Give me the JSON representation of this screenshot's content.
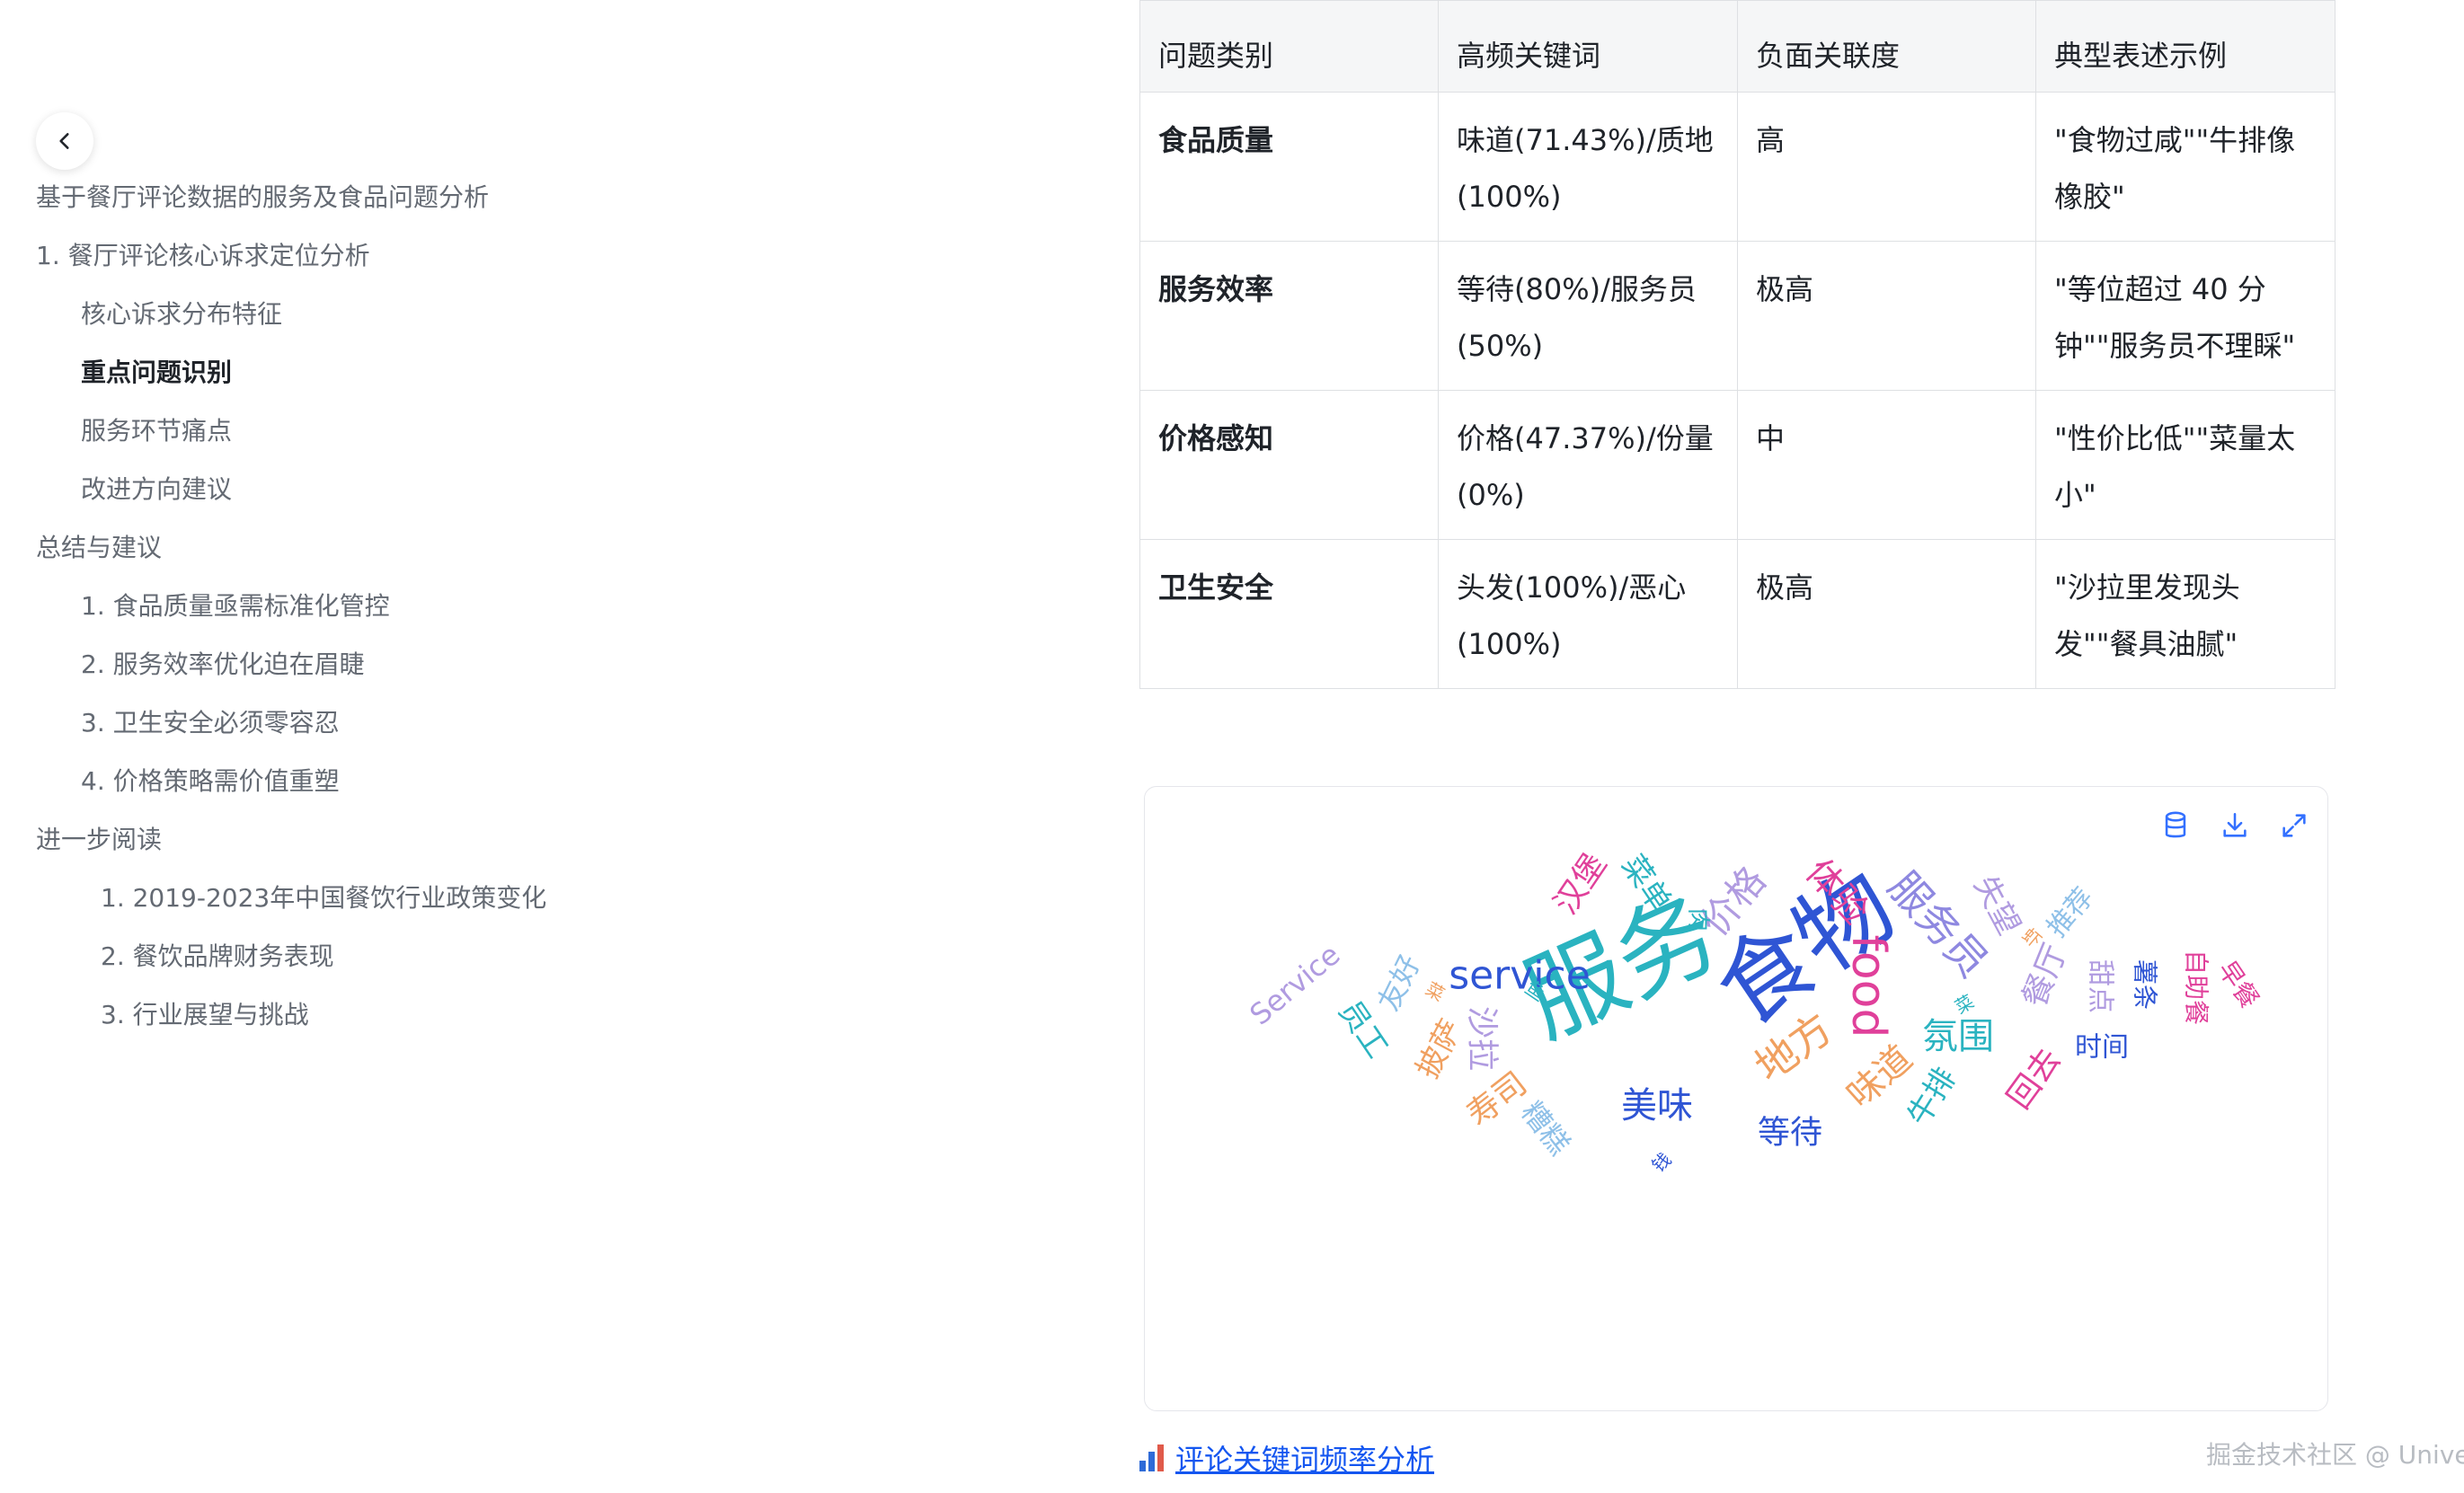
{
  "toc": {
    "items": [
      {
        "label": "基于餐厅评论数据的服务及食品问题分析",
        "level": "l1",
        "active": false
      },
      {
        "label": "1. 餐厅评论核心诉求定位分析",
        "level": "l1",
        "active": false
      },
      {
        "label": "核心诉求分布特征",
        "level": "l2",
        "active": false
      },
      {
        "label": "重点问题识别",
        "level": "l2",
        "active": true
      },
      {
        "label": "服务环节痛点",
        "level": "l2",
        "active": false
      },
      {
        "label": "改进方向建议",
        "level": "l2",
        "active": false
      },
      {
        "label": "总结与建议",
        "level": "l1",
        "active": false
      },
      {
        "label": "1. 食品质量亟需标准化管控",
        "level": "l2",
        "active": false
      },
      {
        "label": "2. 服务效率优化迫在眉睫",
        "level": "l2",
        "active": false
      },
      {
        "label": "3. 卫生安全必须零容忍",
        "level": "l2",
        "active": false
      },
      {
        "label": "4. 价格策略需价值重塑",
        "level": "l2",
        "active": false
      },
      {
        "label": "进一步阅读",
        "level": "l1",
        "active": false
      },
      {
        "label": "1. 2019-2023年中国餐饮行业政策变化",
        "level": "l2n",
        "active": false
      },
      {
        "label": "2. 餐饮品牌财务表现",
        "level": "l2n",
        "active": false
      },
      {
        "label": "3. 行业展望与挑战",
        "level": "l2n",
        "active": false
      }
    ]
  },
  "table": {
    "headers": [
      "问题类别",
      "高频关键词",
      "负面关联度",
      "典型表述示例"
    ],
    "rows": [
      {
        "category": "食品质量",
        "keywords": "味道(71.43%)/质地(100%)",
        "relevance": "高",
        "example": "\"食物过咸\"\"牛排像橡胶\""
      },
      {
        "category": "服务效率",
        "keywords": "等待(80%)/服务员(50%)",
        "relevance": "极高",
        "example": "\"等位超过 40 分钟\"\"服务员不理睬\""
      },
      {
        "category": "价格感知",
        "keywords": "价格(47.37%)/份量(0%)",
        "relevance": "中",
        "example": "\"性价比低\"\"菜量太小\""
      },
      {
        "category": "卫生安全",
        "keywords": "头发(100%)/恶心(100%)",
        "relevance": "极高",
        "example": "\"沙拉里发现头发\"\"餐具油腻\""
      }
    ]
  },
  "chart_data": {
    "type": "wordcloud",
    "words": [
      {
        "text": "服务",
        "weight": 100,
        "color": "#2ab3c0"
      },
      {
        "text": "食物",
        "weight": 96,
        "color": "#2f55d4"
      },
      {
        "text": "service",
        "weight": 42,
        "color": "#2f55d4"
      },
      {
        "text": "food",
        "weight": 40,
        "color": "#e0409a"
      },
      {
        "text": "地方",
        "weight": 38,
        "color": "#f0a060"
      },
      {
        "text": "服务员",
        "weight": 36,
        "color": "#8e88e0"
      },
      {
        "text": "价格",
        "weight": 34,
        "color": "#b09be0"
      },
      {
        "text": "体验",
        "weight": 32,
        "color": "#e0409a"
      },
      {
        "text": "味道",
        "weight": 32,
        "color": "#f0a060"
      },
      {
        "text": "美味",
        "weight": 32,
        "color": "#2f55d4"
      },
      {
        "text": "氛围",
        "weight": 32,
        "color": "#2ab3c0"
      },
      {
        "text": "等待",
        "weight": 28,
        "color": "#2f55d4"
      },
      {
        "text": "沙拉",
        "weight": 28,
        "color": "#b09be0"
      },
      {
        "text": "寿司",
        "weight": 28,
        "color": "#f0a060"
      },
      {
        "text": "汉堡",
        "weight": 28,
        "color": "#e0409a"
      },
      {
        "text": "餐厅",
        "weight": 28,
        "color": "#b09be0"
      },
      {
        "text": "回去",
        "weight": 28,
        "color": "#e0409a"
      },
      {
        "text": "失望",
        "weight": 26,
        "color": "#b09be0"
      },
      {
        "text": "菜单",
        "weight": 26,
        "color": "#2ab3c0"
      },
      {
        "text": "牛排",
        "weight": 26,
        "color": "#2ab3c0"
      },
      {
        "text": "披萨",
        "weight": 26,
        "color": "#f0a060"
      },
      {
        "text": "员工",
        "weight": 26,
        "color": "#2ab3c0"
      },
      {
        "text": "糟糕",
        "weight": 24,
        "color": "#8ec0e8"
      },
      {
        "text": "Service",
        "weight": 24,
        "color": "#b09be0"
      },
      {
        "text": "友好",
        "weight": 24,
        "color": "#8ec0e8"
      },
      {
        "text": "推荐",
        "weight": 24,
        "color": "#8ec0e8"
      },
      {
        "text": "时间",
        "weight": 24,
        "color": "#2f55d4"
      },
      {
        "text": "甜点",
        "weight": 22,
        "color": "#b09be0"
      },
      {
        "text": "薯条",
        "weight": 22,
        "color": "#2f55d4"
      },
      {
        "text": "自助餐",
        "weight": 22,
        "color": "#e0409a"
      },
      {
        "text": "早餐",
        "weight": 22,
        "color": "#e0409a"
      },
      {
        "text": "肉",
        "weight": 18,
        "color": "#2ab3c0"
      },
      {
        "text": "鱼",
        "weight": 16,
        "color": "#2ab3c0"
      },
      {
        "text": "菜",
        "weight": 14,
        "color": "#f0a060"
      },
      {
        "text": "菜",
        "weight": 14,
        "color": "#2ab3c0"
      },
      {
        "text": "钱",
        "weight": 14,
        "color": "#2f55d4"
      },
      {
        "text": "虾",
        "weight": 14,
        "color": "#f0a060"
      }
    ]
  },
  "chart_tools": {
    "data_icon": "database-icon",
    "download_icon": "download-icon",
    "expand_icon": "expand-icon"
  },
  "caption": {
    "text": "评论关键词频率分析",
    "icon": "bar-chart-emoji-icon"
  },
  "watermark": "掘金技术社区 @ Univer"
}
